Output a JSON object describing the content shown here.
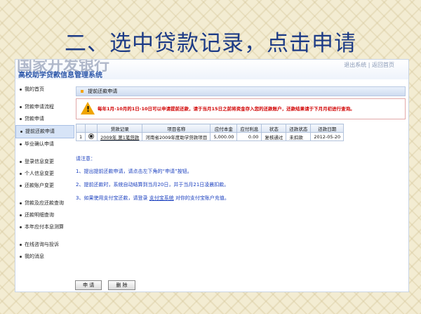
{
  "slide": {
    "title": "二、选中贷款记录，点击申请"
  },
  "system": {
    "faded_heading": "国家开发银行",
    "name": "高校助学贷款信息管理系统",
    "top_right": "退出系统 | 返回首页"
  },
  "sidebar": {
    "groups": [
      [
        "我的首页"
      ],
      [
        "贷款申请流程",
        "贷款申请",
        "提前还款申请",
        "毕业确认申请"
      ],
      [
        "登录信息变更",
        "个人信息变更",
        "还款账户变更"
      ],
      [
        "贷款及应还款查询",
        "还款明细查询",
        "本年应付本息测算"
      ],
      [
        "在线咨询与投诉",
        "我的消息"
      ]
    ],
    "active": "提前还款申请"
  },
  "panel": {
    "header": "提前还款申请"
  },
  "warning": {
    "icon": "!",
    "message": "每年1月-10月的1日-10日可以申请提前还款，请于当月15日之前将资金存入您的还款账户，还款结果请于下月月初进行查询。"
  },
  "table": {
    "headers": [
      "",
      "",
      "贷款记录",
      "项目名称",
      "应付本金",
      "应付利息",
      "状态",
      "还款状态",
      "还款日期"
    ],
    "rows": [
      [
        "1",
        "",
        "2009年 第1笔贷款",
        "河南省2009年度助学贷款项目",
        "5,000.00",
        "0.00",
        "复核通过",
        "未扣款",
        "2012-05-20"
      ]
    ]
  },
  "notes": {
    "heading": "请注意：",
    "lines": [
      "1、提出提前还款申请，请点击左下角的“申请”按钮。",
      "2、提前还款时，系统自动结算到当月20日，并于当月21日凌晨扣款。",
      "3、如果使用支付宝还款，请登录"
    ],
    "link": "支付宝系统",
    "line3_tail": "对你的支付宝账户充值。"
  },
  "buttons": {
    "apply": "申 请",
    "delete": "删 除"
  },
  "colors": {
    "title": "#1d3b86",
    "warning_text": "#d10000",
    "notes": "#1a3fbf"
  }
}
